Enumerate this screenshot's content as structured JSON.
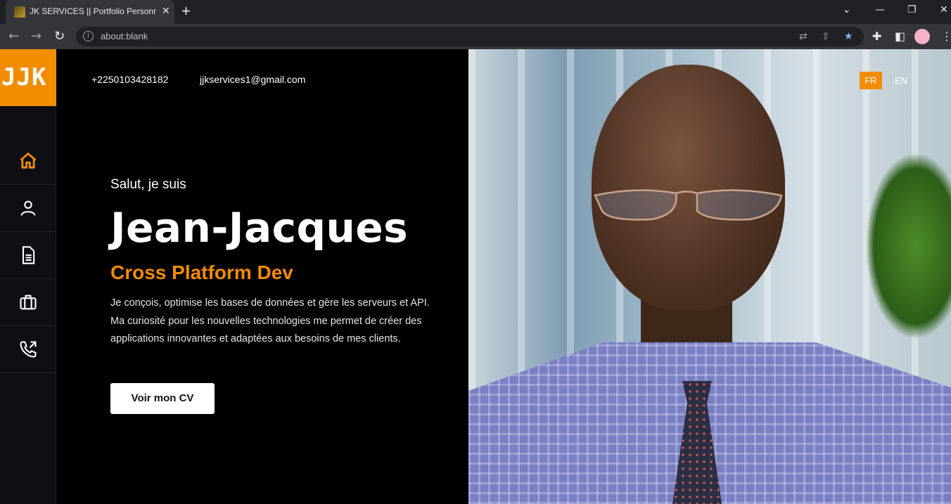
{
  "browser": {
    "tab_title": "JK SERVICES || Portfolio Personnel",
    "url": "about:blank",
    "tab_close": "✕",
    "new_tab": "+"
  },
  "site": {
    "logo": "JJK",
    "phone": "+2250103428182",
    "email": "jjkservices1@gmail.com",
    "languages": [
      "FR",
      "EN"
    ],
    "active_language": "FR"
  },
  "nav": [
    {
      "id": "home",
      "icon": "home-icon",
      "active": true
    },
    {
      "id": "about",
      "icon": "user-icon",
      "active": false
    },
    {
      "id": "resume",
      "icon": "document-icon",
      "active": false
    },
    {
      "id": "portfolio",
      "icon": "briefcase-icon",
      "active": false
    },
    {
      "id": "contact",
      "icon": "phone-icon",
      "active": false
    }
  ],
  "hero": {
    "greeting": "Salut, je suis",
    "name": "Jean-Jacques",
    "role": "Cross Platform Dev",
    "description": "Je conçois, optimise les bases de données et gère les serveurs et API. Ma curiosité pour les nouvelles technologies me permet de créer des applications innovantes et adaptées aux besoins de mes clients.",
    "cta": "Voir mon CV"
  },
  "colors": {
    "accent": "#f28c00",
    "sidebar": "#0d0f14",
    "background": "#000000"
  }
}
